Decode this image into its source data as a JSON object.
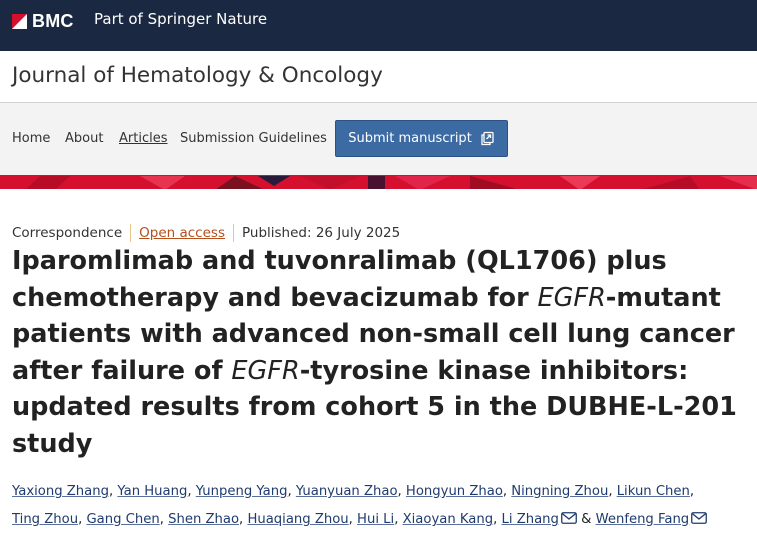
{
  "brand": {
    "logo_text": "BMC",
    "part_of": "Part of Springer Nature",
    "accent": "#d5102e",
    "header_bg": "#1a2841"
  },
  "journal": {
    "title": "Journal of Hematology & Oncology"
  },
  "nav": {
    "items": [
      {
        "label": "Home"
      },
      {
        "label": "About"
      },
      {
        "label": "Articles"
      },
      {
        "label": "Submission Guidelines"
      }
    ],
    "submit_label": "Submit manuscript",
    "submit_icon": "external-link-icon"
  },
  "article": {
    "type": "Correspondence",
    "access": "Open access",
    "published": "Published: 26 July 2025",
    "title_lines": [
      [
        "Iparomlimab and tuvonralimab (QL1706) plus",
        "",
        ""
      ],
      [
        "chemotherapy and bevacizumab for ",
        "EGFR",
        "-mutant"
      ],
      [
        "patients with advanced non-small cell lung cancer",
        "",
        ""
      ],
      [
        "after failure of ",
        "EGFR",
        "-tyrosine kinase inhibitors:"
      ],
      [
        "updated results from cohort 5 in the DUBHE-L-201",
        "",
        ""
      ],
      [
        "study",
        "",
        ""
      ]
    ]
  },
  "authors": {
    "line1": [
      "Yaxiong Zhang",
      "Yan Huang",
      "Yunpeng Yang",
      "Yuanyuan Zhao",
      "Hongyun Zhao",
      "Ningning Zhou",
      "Likun Chen"
    ],
    "line2": [
      "Ting Zhou",
      "Gang Chen",
      "Shen Zhao",
      "Huaqiang Zhou",
      "Hui Li",
      "Xiaoyan Kang",
      "Li Zhang",
      "Wenfeng Fang"
    ],
    "separator": ",",
    "conjunction": "&",
    "mail_icon": "envelope-icon"
  }
}
